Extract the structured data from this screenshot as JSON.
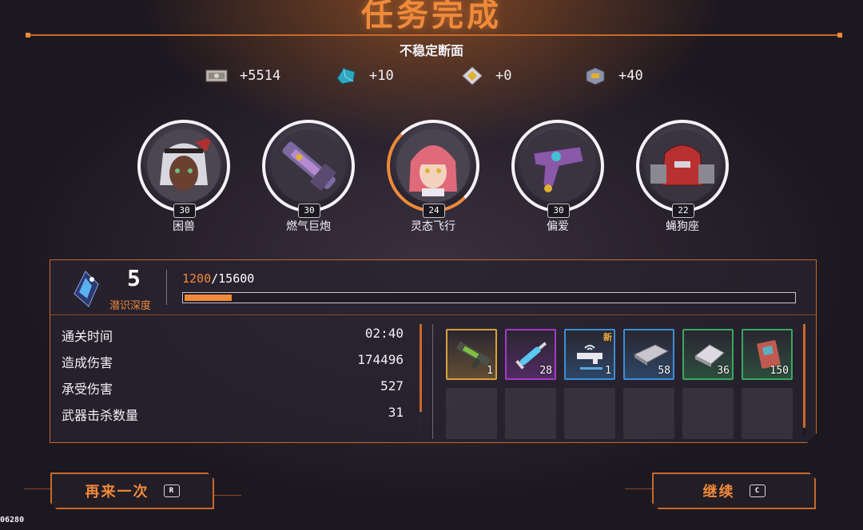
{
  "header": {
    "title": "任务完成",
    "subtitle": "不稳定断面"
  },
  "rewards": [
    {
      "icon": "cash-icon",
      "value": "+5514"
    },
    {
      "icon": "crystal-icon",
      "value": "+10"
    },
    {
      "icon": "gold-gem-icon",
      "value": "+0"
    },
    {
      "icon": "chip-box-icon",
      "value": "+40"
    }
  ],
  "characters": [
    {
      "name": "困兽",
      "level": "30",
      "icon": "character-portrait"
    },
    {
      "name": "燃气巨炮",
      "level": "30",
      "icon": "weapon-portrait"
    },
    {
      "name": "灵态飞行",
      "level": "24",
      "icon": "character-portrait"
    },
    {
      "name": "偏爱",
      "level": "30",
      "icon": "weapon-portrait"
    },
    {
      "name": "蝇狗座",
      "level": "22",
      "icon": "mech-portrait"
    }
  ],
  "depth": {
    "level": "5",
    "label": "潜识深度",
    "xp_current": "1200",
    "xp_separator": "/",
    "xp_total": "15600",
    "progress": 0.077
  },
  "stats": [
    {
      "label": "通关时间",
      "value": "02:40"
    },
    {
      "label": "造成伤害",
      "value": "174496"
    },
    {
      "label": "承受伤害",
      "value": "527"
    },
    {
      "label": "武器击杀数量",
      "value": "31"
    }
  ],
  "items": [
    {
      "icon": "rifle-weapon-icon",
      "count": "1",
      "rarity_color": "#d8a23a",
      "new": ""
    },
    {
      "icon": "syringe-icon",
      "count": "28",
      "rarity_color": "#a43ac8",
      "new": ""
    },
    {
      "icon": "wifi-gun-icon",
      "count": "1",
      "rarity_color": "#3a8fd8",
      "new": "新"
    },
    {
      "icon": "metal-plate-icon",
      "count": "58",
      "rarity_color": "#3a8fd8",
      "new": ""
    },
    {
      "icon": "alloy-ingot-icon",
      "count": "36",
      "rarity_color": "#3aa860",
      "new": ""
    },
    {
      "icon": "circuit-board-icon",
      "count": "150",
      "rarity_color": "#3aa860",
      "new": ""
    }
  ],
  "buttons": {
    "retry": {
      "label": "再来一次",
      "key": "R"
    },
    "continue": {
      "label": "继续",
      "key": "C"
    }
  },
  "uid": "06280",
  "colors": {
    "accent": "#f08a3a",
    "frame": "#c7692c"
  }
}
